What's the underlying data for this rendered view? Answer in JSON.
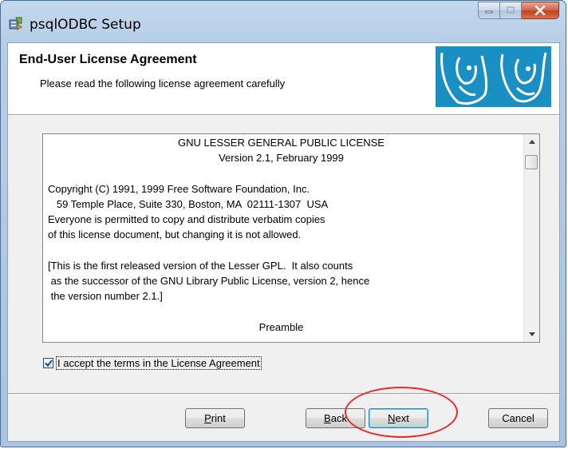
{
  "window": {
    "title": "psqlODBC Setup",
    "icons": {
      "app": "installer-icon",
      "minimize": "minimize-icon",
      "maximize": "maximize-icon",
      "close": "close-icon"
    }
  },
  "banner": {
    "title": "End-User License Agreement",
    "subtitle": "Please read the following license agreement carefully",
    "logo": "postgresql-elephant-logo",
    "logo_color": "#1a8fc3"
  },
  "license": {
    "lines": [
      "GNU LESSER GENERAL PUBLIC LICENSE",
      "Version 2.1, February 1999",
      "Copyright (C) 1991, 1999 Free Software Foundation, Inc.",
      "   59 Temple Place, Suite 330, Boston, MA  02111-1307  USA",
      "Everyone is permitted to copy and distribute verbatim copies",
      "of this license document, but changing it is not allowed.",
      "[This is the first released version of the Lesser GPL.  It also counts",
      " as the successor of the GNU Library Public License, version 2, hence",
      " the version number 2.1.]",
      "Preamble"
    ],
    "scroll_up": "scroll-up-arrow-icon",
    "scroll_down": "scroll-down-arrow-icon"
  },
  "accept": {
    "checked": true,
    "label": "I accept the terms in the License Agreement"
  },
  "buttons": {
    "print": "Print",
    "back": "Back",
    "next": "Next",
    "cancel": "Cancel"
  },
  "highlight_color": "#e52b2b"
}
